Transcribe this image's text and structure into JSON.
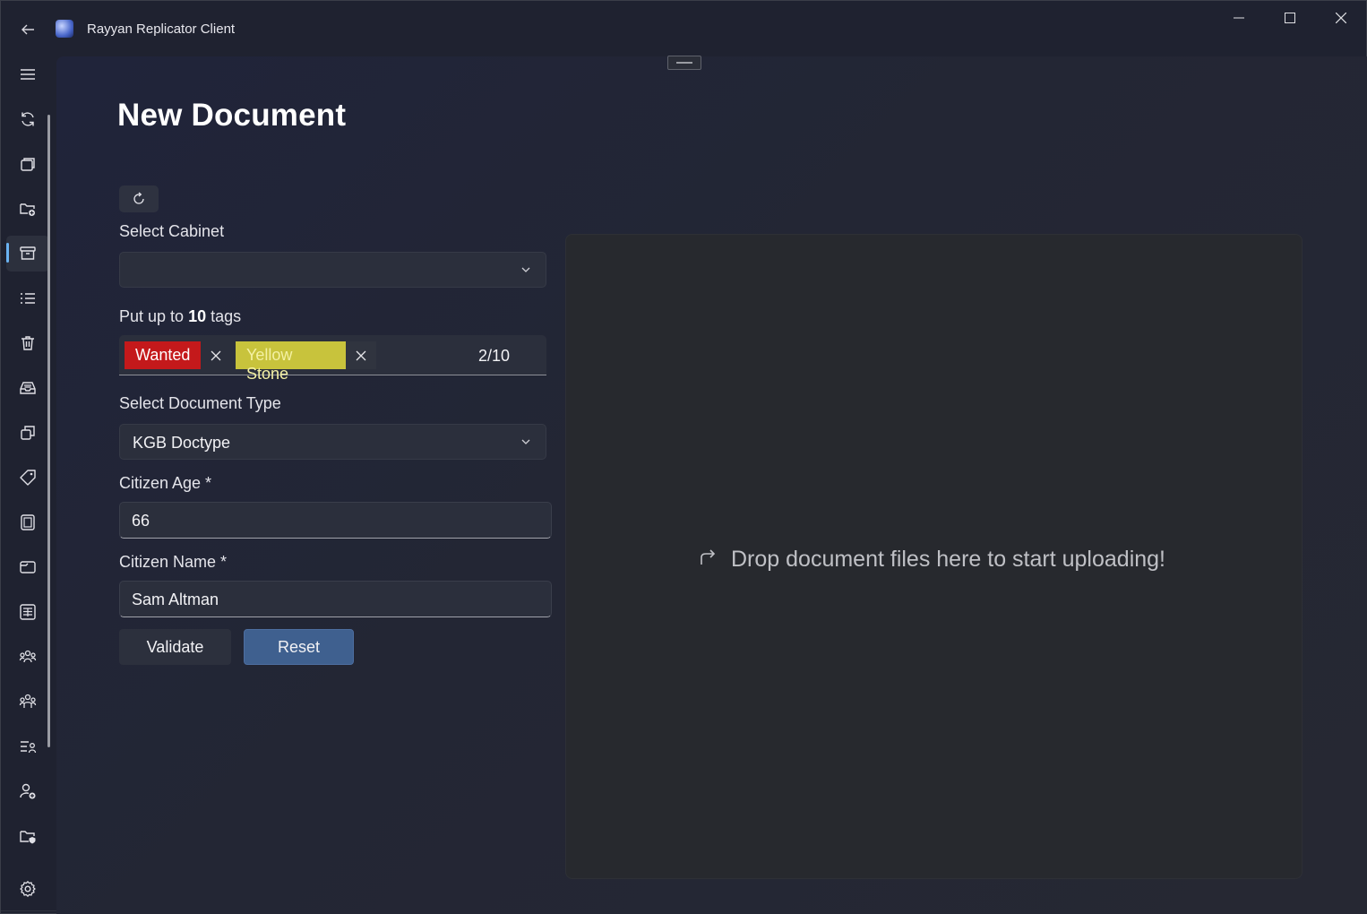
{
  "window": {
    "title": "Rayyan Replicator Client"
  },
  "nav_rail": {
    "items": [
      {
        "icon": "hamburger-menu-icon"
      },
      {
        "icon": "sync-icon"
      },
      {
        "icon": "stacked-pages-icon"
      },
      {
        "icon": "folder-add-icon"
      },
      {
        "icon": "archive-icon",
        "active": true
      },
      {
        "icon": "bulleted-list-icon"
      },
      {
        "icon": "trash-icon"
      },
      {
        "icon": "inbox-tray-icon"
      },
      {
        "icon": "copy-windows-icon"
      },
      {
        "icon": "tag-icon"
      },
      {
        "icon": "document-frame-icon"
      },
      {
        "icon": "tab-folder-icon"
      },
      {
        "icon": "form-grid-icon"
      },
      {
        "icon": "group-people-icon"
      },
      {
        "icon": "group-people-alt-icon"
      },
      {
        "icon": "list-person-icon"
      },
      {
        "icon": "person-add-icon"
      },
      {
        "icon": "folder-shield-icon"
      },
      {
        "icon": "settings-gear-icon"
      }
    ]
  },
  "page": {
    "title": "New Document",
    "cabinet": {
      "label": "Select Cabinet",
      "value": ""
    },
    "tags": {
      "label_prefix": "Put up to ",
      "label_max": "10",
      "label_suffix": " tags",
      "items": [
        {
          "text": "Wanted",
          "color": "#c4191b"
        },
        {
          "text": "Yellow Stone",
          "color": "#c8c33c"
        }
      ],
      "count": "2/10"
    },
    "doctype": {
      "label": "Select Document Type",
      "value": "KGB Doctype"
    },
    "citizen_age": {
      "label": "Citizen Age *",
      "value": "66"
    },
    "citizen_name": {
      "label": "Citizen Name *",
      "value": "Sam Altman"
    },
    "buttons": {
      "validate": "Validate",
      "reset": "Reset"
    },
    "dropzone": {
      "text": "Drop document files here to start uploading!"
    }
  },
  "colors": {
    "accent": "#6ab3f2",
    "primary_button": "#3f608f",
    "background": "#1f2230"
  }
}
